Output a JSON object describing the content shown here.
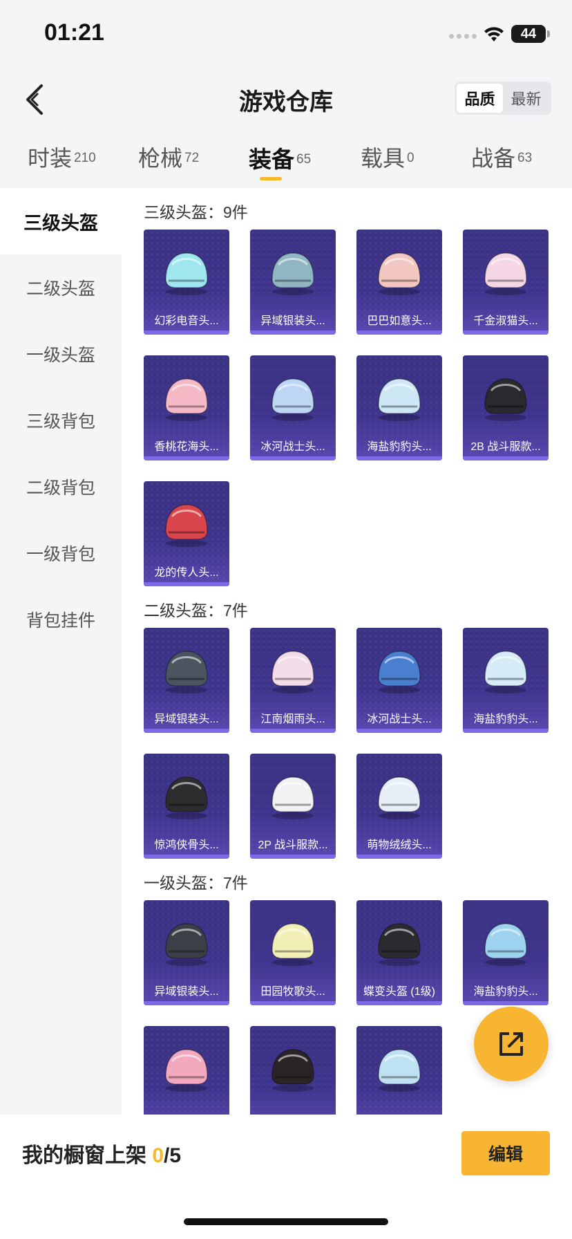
{
  "status_bar": {
    "time": "01:21",
    "battery": "44"
  },
  "header": {
    "title": "游戏仓库",
    "sort_options": [
      "品质",
      "最新"
    ],
    "sort_active": "品质"
  },
  "tabs": [
    {
      "label": "时装",
      "count": "210"
    },
    {
      "label": "枪械",
      "count": "72"
    },
    {
      "label": "装备",
      "count": "65",
      "active": true
    },
    {
      "label": "载具",
      "count": "0"
    },
    {
      "label": "战备",
      "count": "63"
    }
  ],
  "sidebar": {
    "items": [
      "三级头盔",
      "二级头盔",
      "一级头盔",
      "三级背包",
      "二级背包",
      "一级背包",
      "背包挂件"
    ],
    "active": "三级头盔"
  },
  "sections": [
    {
      "title": "三级头盔：9件",
      "items": [
        {
          "name": "幻彩电音头...",
          "color": "#9fe6ee"
        },
        {
          "name": "异域银装头...",
          "color": "#8fb6c2"
        },
        {
          "name": "巴巴如意头...",
          "color": "#f3c7c1"
        },
        {
          "name": "千金淑猫头...",
          "color": "#f5d6e4"
        },
        {
          "name": "香桃花海头...",
          "color": "#f5b9c6"
        },
        {
          "name": "冰河战士头...",
          "color": "#bcd6f3"
        },
        {
          "name": "海盐豹豹头...",
          "color": "#cde7f5"
        },
        {
          "name": "2B 战斗服款...",
          "color": "#2a2a2e"
        },
        {
          "name": "龙的传人头...",
          "color": "#d8454a"
        }
      ]
    },
    {
      "title": "二级头盔：7件",
      "items": [
        {
          "name": "异域银装头...",
          "color": "#4a5560"
        },
        {
          "name": "江南烟雨头...",
          "color": "#f3dbe7"
        },
        {
          "name": "冰河战士头...",
          "color": "#4a7fd0"
        },
        {
          "name": "海盐豹豹头...",
          "color": "#d5ecf7"
        },
        {
          "name": "惊鸿侠骨头...",
          "color": "#2e2c2e"
        },
        {
          "name": "2P 战斗服款...",
          "color": "#f2f2f4"
        },
        {
          "name": "萌物绒绒头...",
          "color": "#e6eef7"
        }
      ]
    },
    {
      "title": "一级头盔：7件",
      "items": [
        {
          "name": "异域银装头...",
          "color": "#3b4048"
        },
        {
          "name": "田园牧歌头...",
          "color": "#f1efb6"
        },
        {
          "name": "蝶变头盔 (1级)",
          "color": "#2b2b2f"
        },
        {
          "name": "海盐豹豹头...",
          "color": "#9dd3ef"
        },
        {
          "name": "",
          "color": "#f2a8bd"
        },
        {
          "name": "",
          "color": "#2b2427"
        },
        {
          "name": "",
          "color": "#bfe2f3"
        }
      ]
    }
  ],
  "bottom_bar": {
    "shelf_label": "我的橱窗上架 ",
    "shelf_current": "0",
    "shelf_total": "/5",
    "edit_label": "编辑"
  }
}
